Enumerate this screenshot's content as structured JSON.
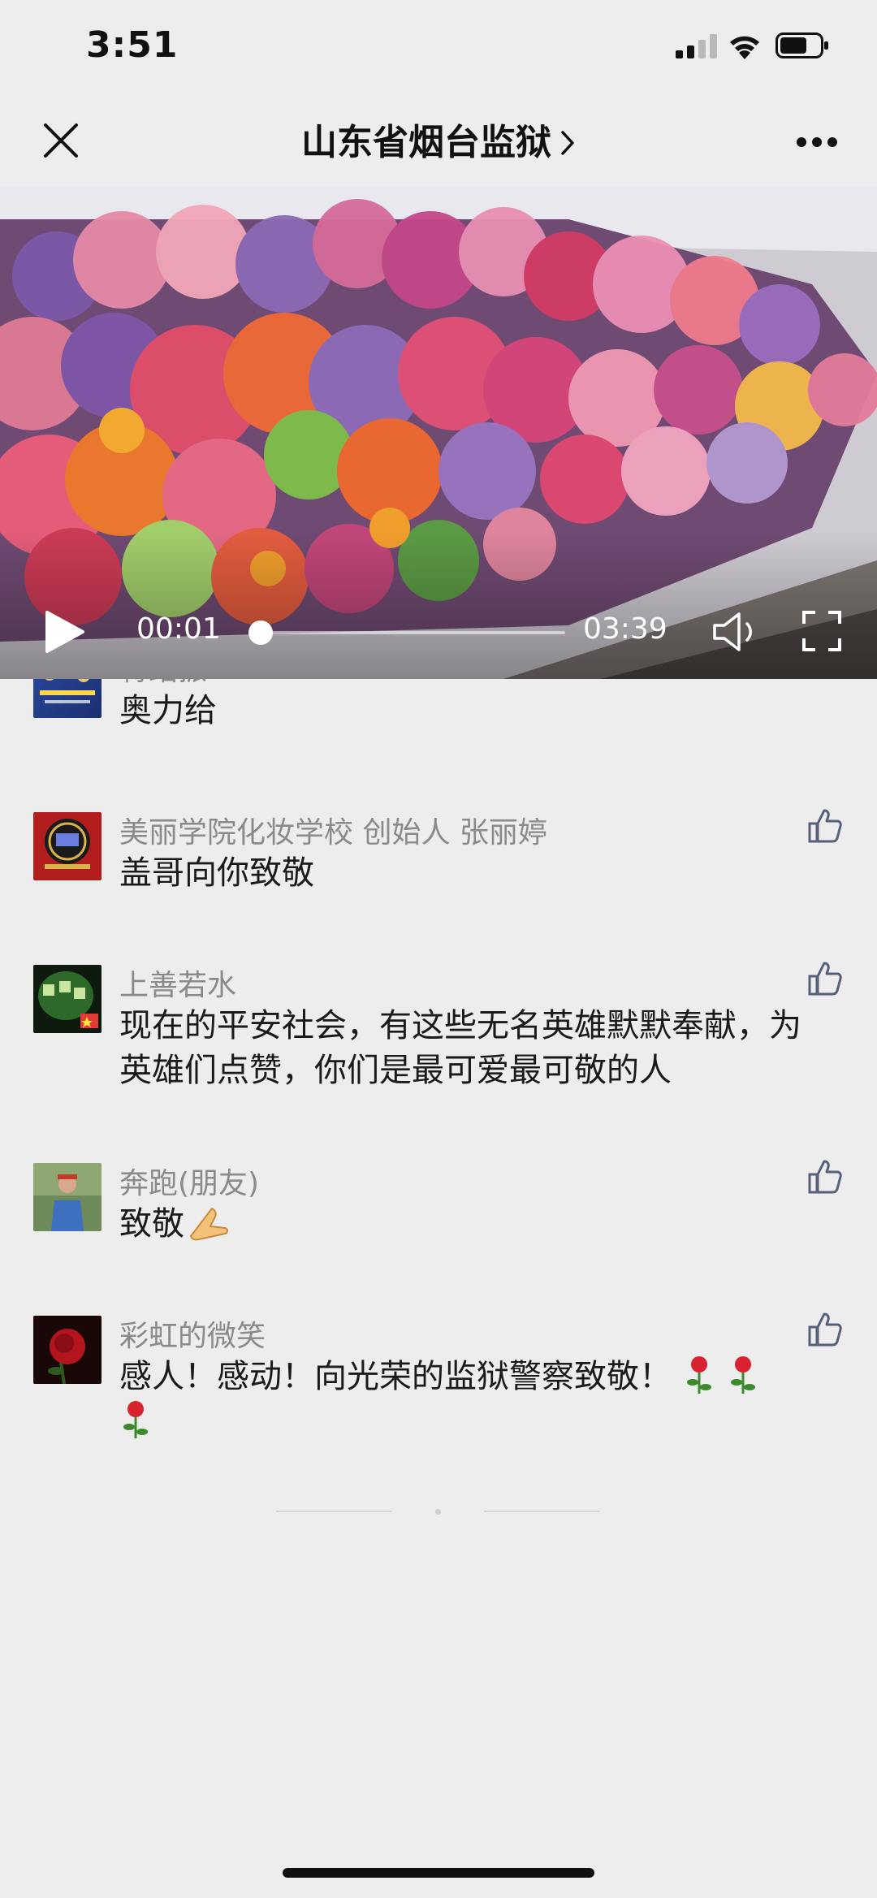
{
  "status": {
    "time": "3:51"
  },
  "nav": {
    "title": "山东省烟台监狱"
  },
  "video": {
    "current_time": "00:01",
    "total_time": "03:39",
    "progress": 0.005
  },
  "comments": [
    {
      "name": "蒋绍振",
      "text": "奥力给"
    },
    {
      "name": "美丽学院化妆学校 创始人 张丽婷",
      "text": "盖哥向你致敬"
    },
    {
      "name": "上善若水",
      "text": "现在的平安社会，有这些无名英雄默默奉献，为英雄们点赞，你们是最可爱最可敬的人"
    },
    {
      "name": "奔跑(朋友)",
      "text": "致敬"
    },
    {
      "name": "彩虹的微笑",
      "text": "感人！感动！向光荣的监狱警察致敬！"
    }
  ],
  "colors": {
    "background": "#ededed",
    "name_gray": "#8a8a8a",
    "like_icon": "#56607a"
  }
}
